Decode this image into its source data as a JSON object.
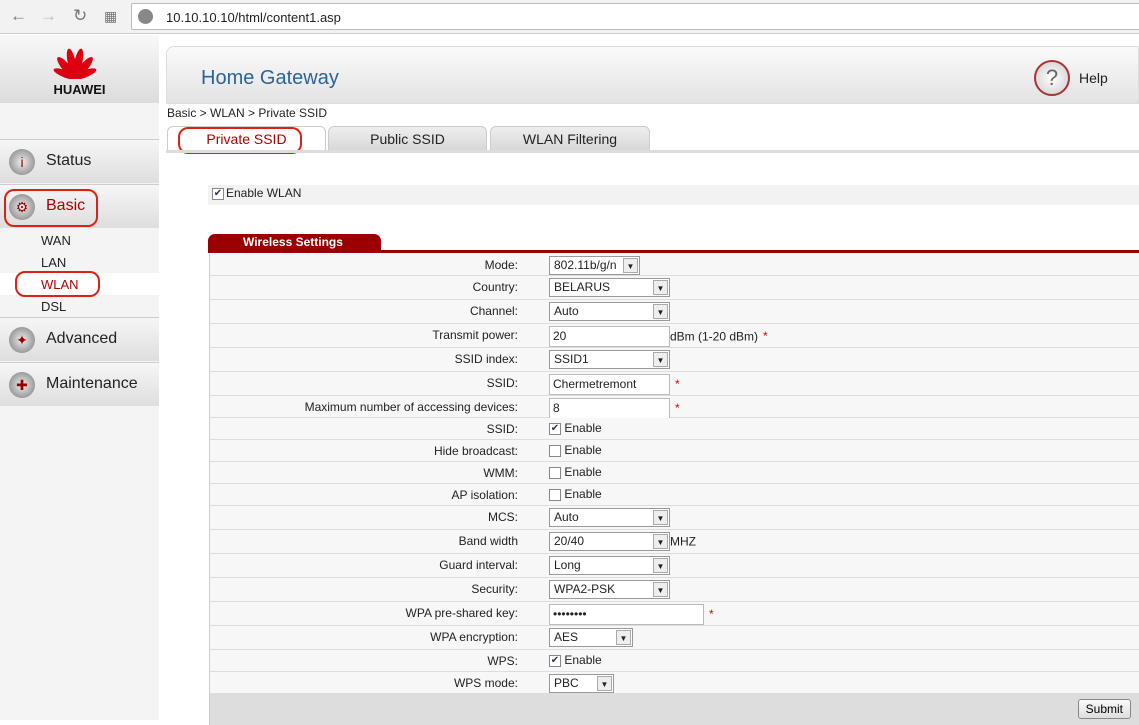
{
  "browser": {
    "url": "10.10.10.10/html/content1.asp"
  },
  "brand": {
    "logo_text": "HUAWEI",
    "title": "Home Gateway",
    "help": "Help"
  },
  "sidebar": {
    "items": [
      {
        "label": "Status"
      },
      {
        "label": "Basic"
      },
      {
        "label": "Advanced"
      },
      {
        "label": "Maintenance"
      }
    ],
    "sub_items": [
      "WAN",
      "LAN",
      "WLAN",
      "DSL"
    ],
    "active_sub": "WLAN"
  },
  "breadcrumb": "Basic > WLAN > Private SSID",
  "tabs": [
    "Private SSID",
    "Public SSID",
    "WLAN Filtering"
  ],
  "enable_wlan": {
    "label": "Enable WLAN",
    "checked": true
  },
  "section_title": "Wireless Settings",
  "rows": [
    {
      "label": "Mode:",
      "type": "select",
      "value": "802.11b/g/n",
      "w": 91
    },
    {
      "label": "Country:",
      "type": "select",
      "value": "BELARUS",
      "w": 121
    },
    {
      "label": "Channel:",
      "type": "select",
      "value": "Auto",
      "w": 121
    },
    {
      "label": "Transmit power:",
      "type": "input",
      "value": "20",
      "w": 121,
      "suffix": "dBm (1-20 dBm)",
      "required": true
    },
    {
      "label": "SSID index:",
      "type": "select",
      "value": "SSID1",
      "w": 121
    },
    {
      "label": "SSID:",
      "type": "input",
      "value": "Chermetremont",
      "w": 121,
      "required": true
    },
    {
      "label": "Maximum number of accessing devices:",
      "type": "input",
      "value": "8",
      "w": 121,
      "required": true
    },
    {
      "label": "SSID:",
      "type": "check",
      "value": "Enable",
      "checked": true
    },
    {
      "label": "Hide broadcast:",
      "type": "check",
      "value": "Enable",
      "checked": false
    },
    {
      "label": "WMM:",
      "type": "check",
      "value": "Enable",
      "checked": false
    },
    {
      "label": "AP isolation:",
      "type": "check",
      "value": "Enable",
      "checked": false
    },
    {
      "label": "MCS:",
      "type": "select",
      "value": "Auto",
      "w": 121
    },
    {
      "label": "Band width",
      "type": "select",
      "value": "20/40",
      "w": 121,
      "suffix": "MHZ"
    },
    {
      "label": "Guard interval:",
      "type": "select",
      "value": "Long",
      "w": 121
    },
    {
      "label": "Security:",
      "type": "select",
      "value": "WPA2-PSK",
      "w": 121
    },
    {
      "label": "WPA pre-shared key:",
      "type": "input",
      "value": "••••••••",
      "w": 155,
      "required": true
    },
    {
      "label": "WPA encryption:",
      "type": "select",
      "value": "AES",
      "w": 84
    },
    {
      "label": "WPS:",
      "type": "check",
      "value": "Enable",
      "checked": true
    },
    {
      "label": "WPS mode:",
      "type": "select",
      "value": "PBC",
      "w": 65
    }
  ],
  "submit": "Submit"
}
